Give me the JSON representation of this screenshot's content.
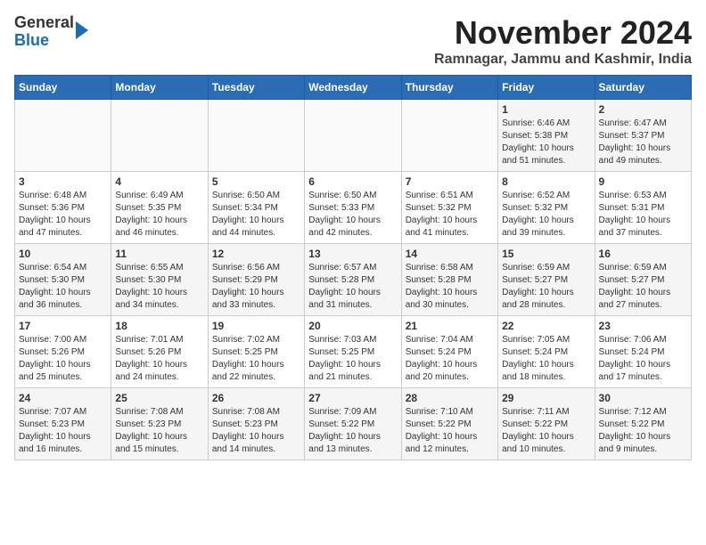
{
  "header": {
    "logo_line1": "General",
    "logo_line2": "Blue",
    "month_title": "November 2024",
    "location": "Ramnagar, Jammu and Kashmir, India"
  },
  "weekdays": [
    "Sunday",
    "Monday",
    "Tuesday",
    "Wednesday",
    "Thursday",
    "Friday",
    "Saturday"
  ],
  "weeks": [
    [
      {
        "day": "",
        "info": ""
      },
      {
        "day": "",
        "info": ""
      },
      {
        "day": "",
        "info": ""
      },
      {
        "day": "",
        "info": ""
      },
      {
        "day": "",
        "info": ""
      },
      {
        "day": "1",
        "info": "Sunrise: 6:46 AM\nSunset: 5:38 PM\nDaylight: 10 hours\nand 51 minutes."
      },
      {
        "day": "2",
        "info": "Sunrise: 6:47 AM\nSunset: 5:37 PM\nDaylight: 10 hours\nand 49 minutes."
      }
    ],
    [
      {
        "day": "3",
        "info": "Sunrise: 6:48 AM\nSunset: 5:36 PM\nDaylight: 10 hours\nand 47 minutes."
      },
      {
        "day": "4",
        "info": "Sunrise: 6:49 AM\nSunset: 5:35 PM\nDaylight: 10 hours\nand 46 minutes."
      },
      {
        "day": "5",
        "info": "Sunrise: 6:50 AM\nSunset: 5:34 PM\nDaylight: 10 hours\nand 44 minutes."
      },
      {
        "day": "6",
        "info": "Sunrise: 6:50 AM\nSunset: 5:33 PM\nDaylight: 10 hours\nand 42 minutes."
      },
      {
        "day": "7",
        "info": "Sunrise: 6:51 AM\nSunset: 5:32 PM\nDaylight: 10 hours\nand 41 minutes."
      },
      {
        "day": "8",
        "info": "Sunrise: 6:52 AM\nSunset: 5:32 PM\nDaylight: 10 hours\nand 39 minutes."
      },
      {
        "day": "9",
        "info": "Sunrise: 6:53 AM\nSunset: 5:31 PM\nDaylight: 10 hours\nand 37 minutes."
      }
    ],
    [
      {
        "day": "10",
        "info": "Sunrise: 6:54 AM\nSunset: 5:30 PM\nDaylight: 10 hours\nand 36 minutes."
      },
      {
        "day": "11",
        "info": "Sunrise: 6:55 AM\nSunset: 5:30 PM\nDaylight: 10 hours\nand 34 minutes."
      },
      {
        "day": "12",
        "info": "Sunrise: 6:56 AM\nSunset: 5:29 PM\nDaylight: 10 hours\nand 33 minutes."
      },
      {
        "day": "13",
        "info": "Sunrise: 6:57 AM\nSunset: 5:28 PM\nDaylight: 10 hours\nand 31 minutes."
      },
      {
        "day": "14",
        "info": "Sunrise: 6:58 AM\nSunset: 5:28 PM\nDaylight: 10 hours\nand 30 minutes."
      },
      {
        "day": "15",
        "info": "Sunrise: 6:59 AM\nSunset: 5:27 PM\nDaylight: 10 hours\nand 28 minutes."
      },
      {
        "day": "16",
        "info": "Sunrise: 6:59 AM\nSunset: 5:27 PM\nDaylight: 10 hours\nand 27 minutes."
      }
    ],
    [
      {
        "day": "17",
        "info": "Sunrise: 7:00 AM\nSunset: 5:26 PM\nDaylight: 10 hours\nand 25 minutes."
      },
      {
        "day": "18",
        "info": "Sunrise: 7:01 AM\nSunset: 5:26 PM\nDaylight: 10 hours\nand 24 minutes."
      },
      {
        "day": "19",
        "info": "Sunrise: 7:02 AM\nSunset: 5:25 PM\nDaylight: 10 hours\nand 22 minutes."
      },
      {
        "day": "20",
        "info": "Sunrise: 7:03 AM\nSunset: 5:25 PM\nDaylight: 10 hours\nand 21 minutes."
      },
      {
        "day": "21",
        "info": "Sunrise: 7:04 AM\nSunset: 5:24 PM\nDaylight: 10 hours\nand 20 minutes."
      },
      {
        "day": "22",
        "info": "Sunrise: 7:05 AM\nSunset: 5:24 PM\nDaylight: 10 hours\nand 18 minutes."
      },
      {
        "day": "23",
        "info": "Sunrise: 7:06 AM\nSunset: 5:24 PM\nDaylight: 10 hours\nand 17 minutes."
      }
    ],
    [
      {
        "day": "24",
        "info": "Sunrise: 7:07 AM\nSunset: 5:23 PM\nDaylight: 10 hours\nand 16 minutes."
      },
      {
        "day": "25",
        "info": "Sunrise: 7:08 AM\nSunset: 5:23 PM\nDaylight: 10 hours\nand 15 minutes."
      },
      {
        "day": "26",
        "info": "Sunrise: 7:08 AM\nSunset: 5:23 PM\nDaylight: 10 hours\nand 14 minutes."
      },
      {
        "day": "27",
        "info": "Sunrise: 7:09 AM\nSunset: 5:22 PM\nDaylight: 10 hours\nand 13 minutes."
      },
      {
        "day": "28",
        "info": "Sunrise: 7:10 AM\nSunset: 5:22 PM\nDaylight: 10 hours\nand 12 minutes."
      },
      {
        "day": "29",
        "info": "Sunrise: 7:11 AM\nSunset: 5:22 PM\nDaylight: 10 hours\nand 10 minutes."
      },
      {
        "day": "30",
        "info": "Sunrise: 7:12 AM\nSunset: 5:22 PM\nDaylight: 10 hours\nand 9 minutes."
      }
    ]
  ]
}
